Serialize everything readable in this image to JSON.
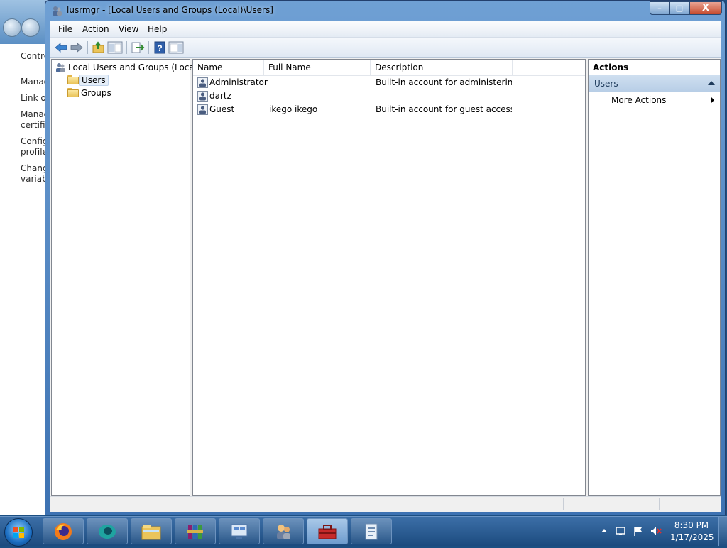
{
  "background_window": {
    "links": [
      "Contro",
      "Manag",
      "Link or",
      "Manag",
      "certifi",
      "Config",
      "profile",
      "Chang",
      "variabl"
    ]
  },
  "window": {
    "title": "lusrmgr - [Local Users and Groups (Local)\\Users]",
    "caption_buttons": {
      "minimize": "–",
      "maximize": "□",
      "close": "X"
    }
  },
  "menubar": {
    "items": [
      "File",
      "Action",
      "View",
      "Help"
    ]
  },
  "toolbar": {
    "icons": [
      "back-arrow-icon",
      "forward-arrow-icon",
      "up-folder-icon",
      "show-hide-console-tree-icon",
      "export-list-icon",
      "help-icon",
      "show-hide-action-pane-icon"
    ]
  },
  "tree": {
    "root": "Local Users and Groups (Local)",
    "children": [
      {
        "label": "Users",
        "selected": true
      },
      {
        "label": "Groups",
        "selected": false
      }
    ]
  },
  "list": {
    "columns": [
      "Name",
      "Full Name",
      "Description"
    ],
    "rows": [
      {
        "name": "Administrator",
        "full_name": "",
        "description": "Built-in account for administering..."
      },
      {
        "name": "dartz",
        "full_name": "",
        "description": ""
      },
      {
        "name": "Guest",
        "full_name": "ikego ikego",
        "description": "Built-in account for guest access t..."
      }
    ]
  },
  "actions": {
    "header": "Actions",
    "section": "Users",
    "items": [
      "More Actions"
    ]
  },
  "taskbar": {
    "apps": [
      "firefox-icon",
      "app-icon",
      "file-explorer-icon",
      "winrar-icon",
      "control-panel-icon",
      "users-icon",
      "toolbox-icon",
      "document-icon"
    ],
    "time": "8:30 PM",
    "date": "1/17/2025"
  }
}
